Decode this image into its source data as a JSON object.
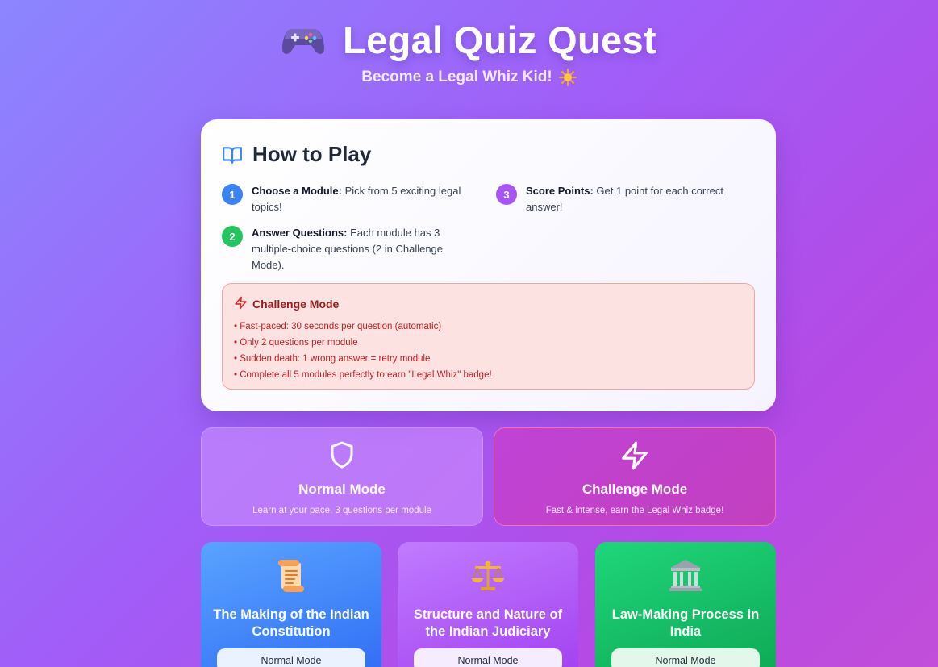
{
  "header": {
    "title": "Legal Quiz Quest",
    "subtitle": "Become a Legal Whiz Kid!",
    "title_icon": "game-controller-icon",
    "subtitle_icon": "sparkle-sun-icon"
  },
  "how_to_play": {
    "title": "How to Play",
    "icon": "open-book-icon",
    "steps": [
      {
        "number": "1",
        "label": "Choose a Module:",
        "text": " Pick from 5 exciting legal topics!",
        "color": "#3b82f6"
      },
      {
        "number": "2",
        "label": "Answer Questions:",
        "text": " Each module has 3 multiple-choice questions (2 in Challenge Mode).",
        "color": "#22c55e"
      },
      {
        "number": "3",
        "label": "Score Points:",
        "text": " Get 1 point for each correct answer!",
        "color": "#a855f7"
      }
    ],
    "challenge": {
      "title": "Challenge Mode",
      "icon": "lightning-icon",
      "rules": [
        "• Fast-paced: 30 seconds per question (automatic)",
        "• Only 2 questions per module",
        "• Sudden death: 1 wrong answer = retry module",
        "• Complete all 5 modules perfectly to earn \"Legal Whiz\" badge!"
      ]
    }
  },
  "modes": {
    "normal": {
      "title": "Normal Mode",
      "desc": "Learn at your pace, 3 questions per module",
      "icon": "shield-icon"
    },
    "challenge": {
      "title": "Challenge Mode",
      "desc": "Fast & intense, earn the Legal Whiz badge!",
      "icon": "lightning-icon"
    }
  },
  "modules": [
    {
      "title": "The Making of the Indian Constitution",
      "mode": "Normal Mode",
      "icon": "scroll-icon"
    },
    {
      "title": "Structure and Nature of the Indian Judiciary",
      "mode": "Normal Mode",
      "icon": "balance-scale-icon"
    },
    {
      "title": "Law-Making Process in India",
      "mode": "Normal Mode",
      "icon": "classical-building-icon"
    }
  ],
  "colors": {
    "background_start": "#8b86ff",
    "background_end": "#c24ed9",
    "challenge_red": "#991b1b"
  }
}
